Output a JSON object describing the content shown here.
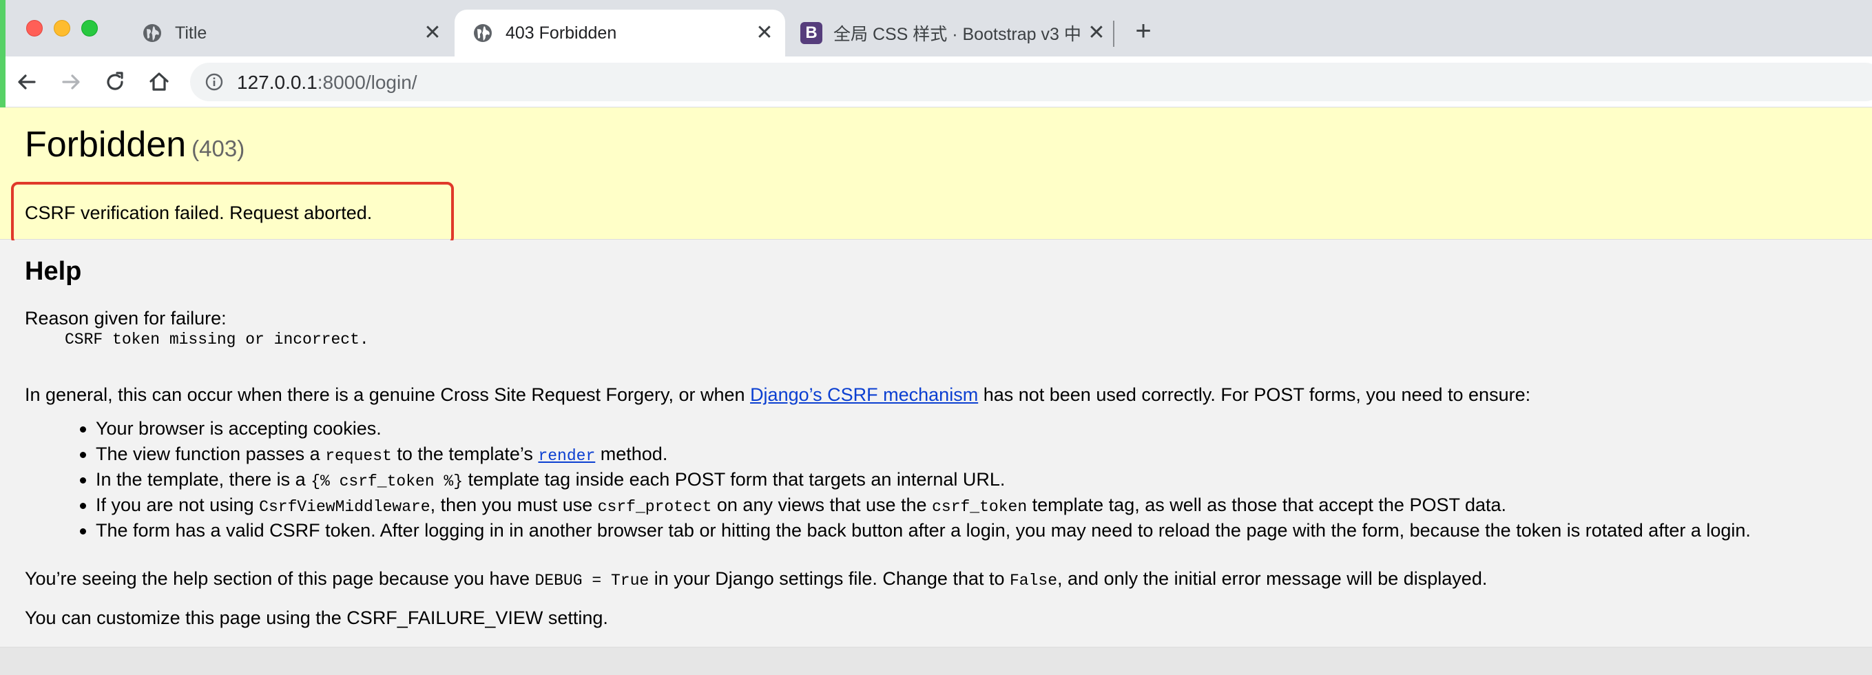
{
  "browser": {
    "tabs": [
      {
        "title": "Title",
        "icon": "globe-icon",
        "active": false
      },
      {
        "title": "403 Forbidden",
        "icon": "globe-icon",
        "active": true
      },
      {
        "title": "全局 CSS 样式 · Bootstrap v3 中",
        "icon": "bootstrap-icon",
        "active": false
      }
    ],
    "bootstrap_letter": "B",
    "close_glyph": "✕",
    "new_tab_glyph": "+",
    "url_host": "127.0.0.1",
    "url_rest": ":8000/login/",
    "colors": {
      "tabstrip": "#dee1e6",
      "accent": "#57d166",
      "summary_bg": "#ffffc8",
      "highlight_border": "#e0392a",
      "link": "#0b3fd1"
    }
  },
  "page": {
    "title": "Forbidden",
    "status_code": "(403)",
    "summary_message": "CSRF verification failed. Request aborted.",
    "help_heading": "Help",
    "reason_label": "Reason given for failure:",
    "reason_value": "CSRF token missing or incorrect.",
    "general_intro": "In general, this can occur when there is a genuine Cross Site Request Forgery, or when ",
    "general_link": "Django’s CSRF mechanism",
    "general_outro": " has not been used correctly. For POST forms, you need to ensure:",
    "bullets": {
      "b1": "Your browser is accepting cookies.",
      "b2_a": "The view function passes a ",
      "b2_code": "request",
      "b2_b": " to the template’s ",
      "b2_link": "render",
      "b2_c": " method.",
      "b3_a": "In the template, there is a ",
      "b3_code": "{% csrf_token %}",
      "b3_b": " template tag inside each POST form that targets an internal URL.",
      "b4_a": "If you are not using ",
      "b4_code1": "CsrfViewMiddleware",
      "b4_b": ", then you must use ",
      "b4_code2": "csrf_protect",
      "b4_c": " on any views that use the ",
      "b4_code3": "csrf_token",
      "b4_d": " template tag, as well as those that accept the POST data.",
      "b5": "The form has a valid CSRF token. After logging in in another browser tab or hitting the back button after a login, you may need to reload the page with the form, because the token is rotated after a login."
    },
    "debug_a": "You’re seeing the help section of this page because you have ",
    "debug_code1": "DEBUG = True",
    "debug_b": " in your Django settings file. Change that to ",
    "debug_code2": "False",
    "debug_c": ", and only the initial error message will be displayed.",
    "customize": "You can customize this page using the CSRF_FAILURE_VIEW setting."
  }
}
